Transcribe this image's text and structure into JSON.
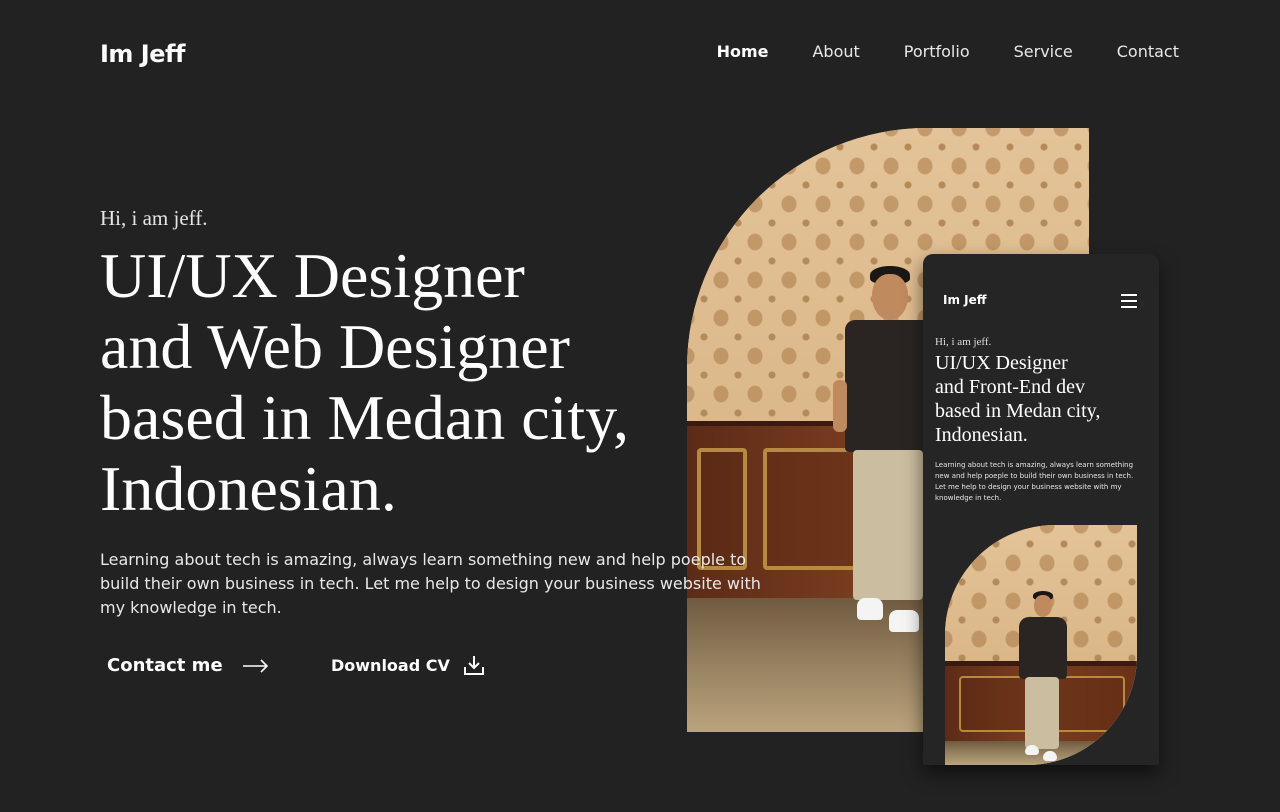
{
  "header": {
    "logo": "Im Jeff",
    "nav": [
      "Home",
      "About",
      "Portfolio",
      "Service",
      "Contact"
    ],
    "active_nav": "Home"
  },
  "hero": {
    "greeting": "Hi, i am jeff.",
    "title_lines": [
      "UI/UX Designer",
      "and Web Designer",
      "based in Medan city,",
      "Indonesian."
    ],
    "description": "Learning about tech is amazing, always learn something new and help poeple to build their own business in tech. Let me help to design your business website with my knowledge in tech.",
    "contact_button": "Contact me",
    "download_button": "Download CV"
  },
  "mobile_preview": {
    "logo": "Im Jeff",
    "greeting": "Hi, i am jeff.",
    "title_lines": [
      "UI/UX Designer",
      "and Front-End dev",
      "based in Medan city,",
      "Indonesian."
    ],
    "description": "Learning about tech is amazing, always learn something new and help poeple to build their own business in tech. Let me help to design your business website with my knowledge in tech."
  },
  "colors": {
    "background": "#222222",
    "text": "#ffffff",
    "wall": "#ddb98a",
    "wood_panel": "#6b3219"
  },
  "icons": {
    "contact": "arrow-right-icon",
    "download": "download-icon",
    "mobile_menu": "hamburger-menu-icon"
  }
}
